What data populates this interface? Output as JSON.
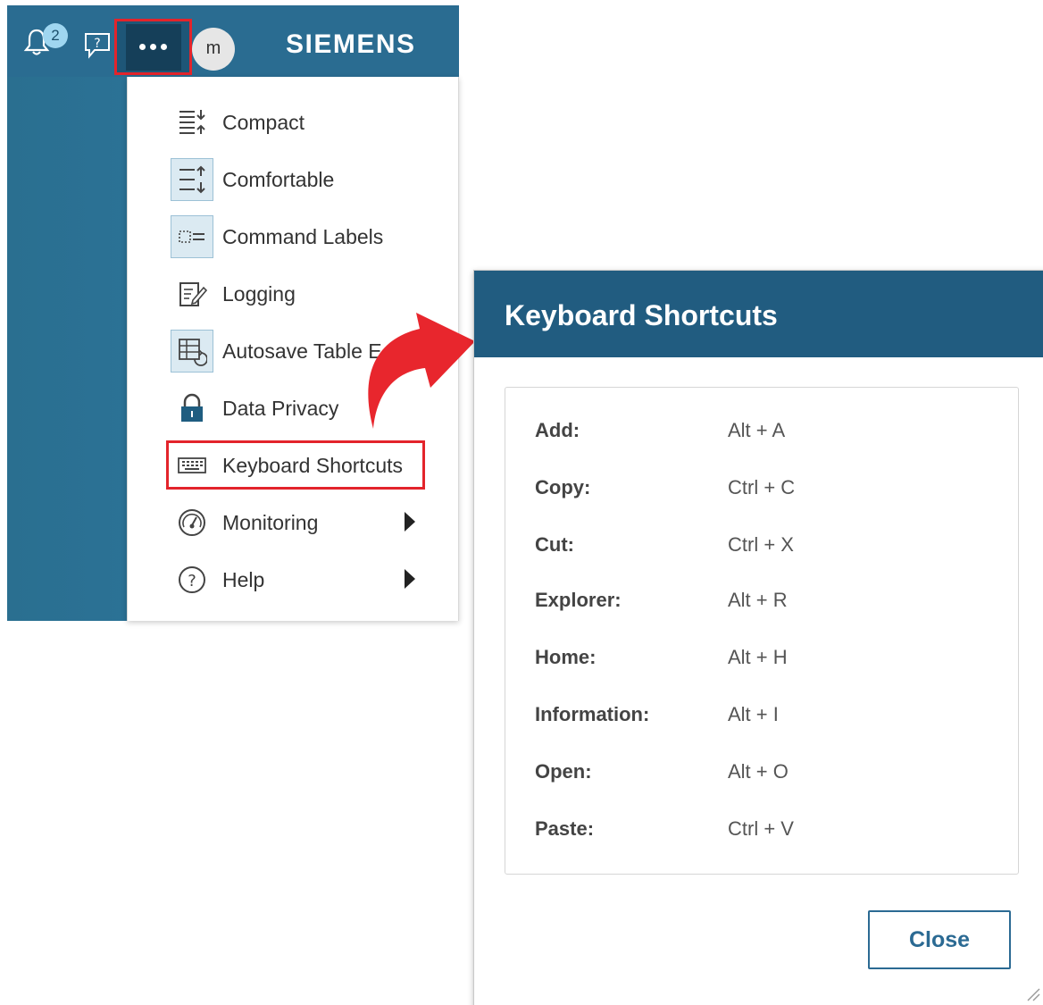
{
  "header": {
    "notifications_count": "2",
    "avatar_initial": "m",
    "logo_text": "SIEMENS",
    "icons": [
      "bell-icon",
      "feedback-icon",
      "more-options-icon"
    ]
  },
  "menu": {
    "items": [
      {
        "label": "Compact",
        "icon": "compact-density-icon",
        "boxed": false,
        "submenu": false
      },
      {
        "label": "Comfortable",
        "icon": "comfortable-density-icon",
        "boxed": true,
        "submenu": false
      },
      {
        "label": "Command Labels",
        "icon": "command-labels-icon",
        "boxed": true,
        "submenu": false
      },
      {
        "label": "Logging",
        "icon": "logging-icon",
        "boxed": false,
        "submenu": false
      },
      {
        "label": "Autosave Table E",
        "icon": "autosave-table-icon",
        "boxed": true,
        "submenu": false
      },
      {
        "label": "Data Privacy",
        "icon": "lock-icon",
        "boxed": false,
        "submenu": false
      },
      {
        "label": "Keyboard Shortcuts",
        "icon": "keyboard-icon",
        "boxed": false,
        "submenu": false
      },
      {
        "label": "Monitoring",
        "icon": "gauge-icon",
        "boxed": false,
        "submenu": true
      },
      {
        "label": "Help",
        "icon": "help-icon",
        "boxed": false,
        "submenu": true
      }
    ]
  },
  "dialog": {
    "title": "Keyboard Shortcuts",
    "shortcuts": [
      {
        "name": "Add:",
        "keys": "Alt + A"
      },
      {
        "name": "Copy:",
        "keys": "Ctrl + C"
      },
      {
        "name": "Cut:",
        "keys": "Ctrl + X"
      },
      {
        "name": "Explorer:",
        "keys": "Alt + R"
      },
      {
        "name": "Home:",
        "keys": "Alt + H"
      },
      {
        "name": "Information:",
        "keys": "Alt + I"
      },
      {
        "name": "Open:",
        "keys": "Alt + O"
      },
      {
        "name": "Paste:",
        "keys": "Ctrl + V"
      }
    ],
    "close_label": "Close"
  },
  "colors": {
    "header_bg": "#2a6c91",
    "dialog_header_bg": "#215c80",
    "highlight_red": "#e3242b",
    "accent": "#2b6a93"
  }
}
